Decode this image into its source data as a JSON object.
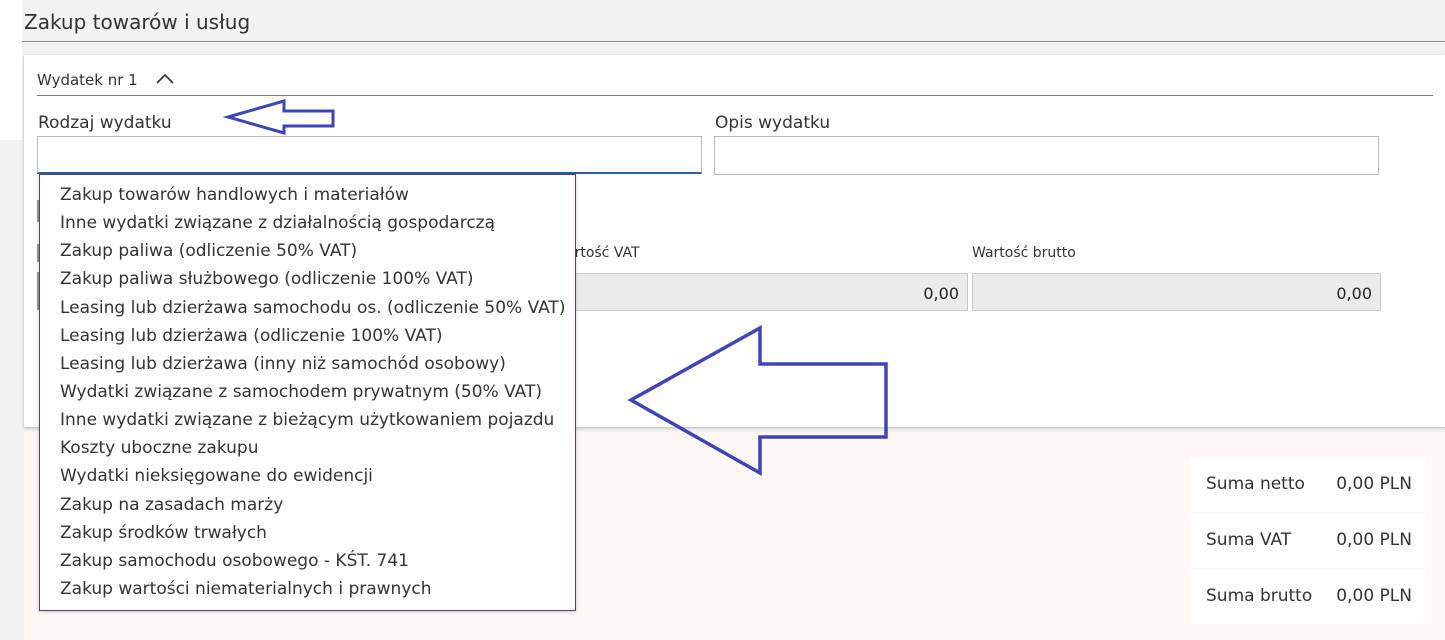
{
  "page": {
    "title": "Zakup towarów i usług"
  },
  "expense": {
    "header": "Wydatek nr 1",
    "type_label": "Rodzaj wydatku",
    "type_value": "",
    "desc_label": "Opis wydatku",
    "desc_value": "",
    "vat_label": "artość VAT",
    "vat_value": "0,00",
    "gross_label": "Wartość brutto",
    "gross_value": "0,00"
  },
  "dropdown": {
    "items": [
      "Zakup towarów handlowych i materiałów",
      "Inne wydatki związane z działalnością gospodarczą",
      "Zakup paliwa (odliczenie 50% VAT)",
      "Zakup paliwa służbowego (odliczenie 100% VAT)",
      "Leasing lub dzierżawa samochodu os. (odliczenie 50% VAT)",
      "Leasing lub dzierżawa (odliczenie 100% VAT)",
      "Leasing lub dzierżawa (inny niż samochód osobowy)",
      "Wydatki związane z samochodem prywatnym (50% VAT)",
      "Inne wydatki związane z bieżącym użytkowaniem pojazdu",
      "Koszty uboczne zakupu",
      "Wydatki nieksięgowane do ewidencji",
      "Zakup na zasadach marży",
      "Zakup środków trwałych",
      "Zakup samochodu osobowego - KŚT. 741",
      "Zakup wartości niematerialnych i prawnych"
    ]
  },
  "summary": {
    "net_label": "Suma netto",
    "net_value": "0,00 PLN",
    "vat_label": "Suma VAT",
    "vat_value": "0,00 PLN",
    "gross_label": "Suma brutto",
    "gross_value": "0,00 PLN"
  },
  "icons": {
    "collapse": "chevron-up-icon",
    "annotation": "arrow-annotation"
  },
  "colors": {
    "annotation_arrow": "#3d45b8",
    "dropdown_border": "#5a3f86",
    "focus_underline": "#2d5f9a"
  }
}
